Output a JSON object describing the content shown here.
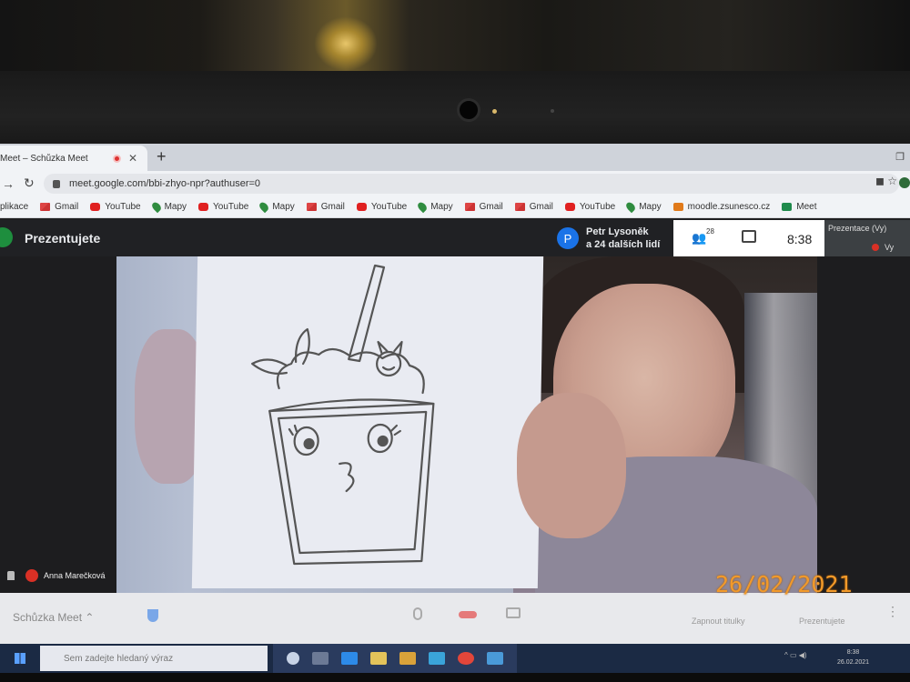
{
  "browser": {
    "tab_title": "Meet – Schůzka Meet",
    "url": "meet.google.com/bbi-zhyo-npr?authuser=0",
    "bookmarks": [
      {
        "label": "plikace",
        "icon": "apps-icon"
      },
      {
        "label": "Gmail",
        "icon": "gmail-icon"
      },
      {
        "label": "YouTube",
        "icon": "youtube-icon"
      },
      {
        "label": "Mapy",
        "icon": "maps-icon"
      },
      {
        "label": "YouTube",
        "icon": "youtube-icon"
      },
      {
        "label": "Mapy",
        "icon": "maps-icon"
      },
      {
        "label": "Gmail",
        "icon": "gmail-icon"
      },
      {
        "label": "YouTube",
        "icon": "youtube-icon"
      },
      {
        "label": "Mapy",
        "icon": "maps-icon"
      },
      {
        "label": "Gmail",
        "icon": "gmail-icon"
      },
      {
        "label": "Gmail",
        "icon": "gmail-icon"
      },
      {
        "label": "YouTube",
        "icon": "youtube-icon"
      },
      {
        "label": "Mapy",
        "icon": "maps-icon"
      },
      {
        "label": "moodle.zsunesco.cz",
        "icon": "moodle-icon"
      },
      {
        "label": "Meet",
        "icon": "meet-icon"
      }
    ]
  },
  "meet": {
    "status": "Prezentujete",
    "presenter_initial": "P",
    "presenter_name": "Petr Lysoněk",
    "presenter_others": "a 24 dalších lidí",
    "participant_count": "28",
    "time": "8:38",
    "self_tile_label": "Prezentace (Vy)",
    "self_tile_vy": "Vy",
    "participant_name": "Anna Marečková",
    "meeting_details": "Schůzka Meet",
    "caption_label": "Zapnout titulky",
    "present_label": "Prezentujete"
  },
  "taskbar": {
    "search_placeholder": "Sem zadejte hledaný výraz",
    "time": "8:38",
    "date": "26.02.2021"
  },
  "photo_date_stamp": "26/02/2021",
  "colors": {
    "meet_dark": "#202124",
    "meet_green": "#1e8e3e",
    "presenter_blue": "#1a73e8",
    "mic_red": "#d93025",
    "stamp_orange": "#f29a2a"
  }
}
